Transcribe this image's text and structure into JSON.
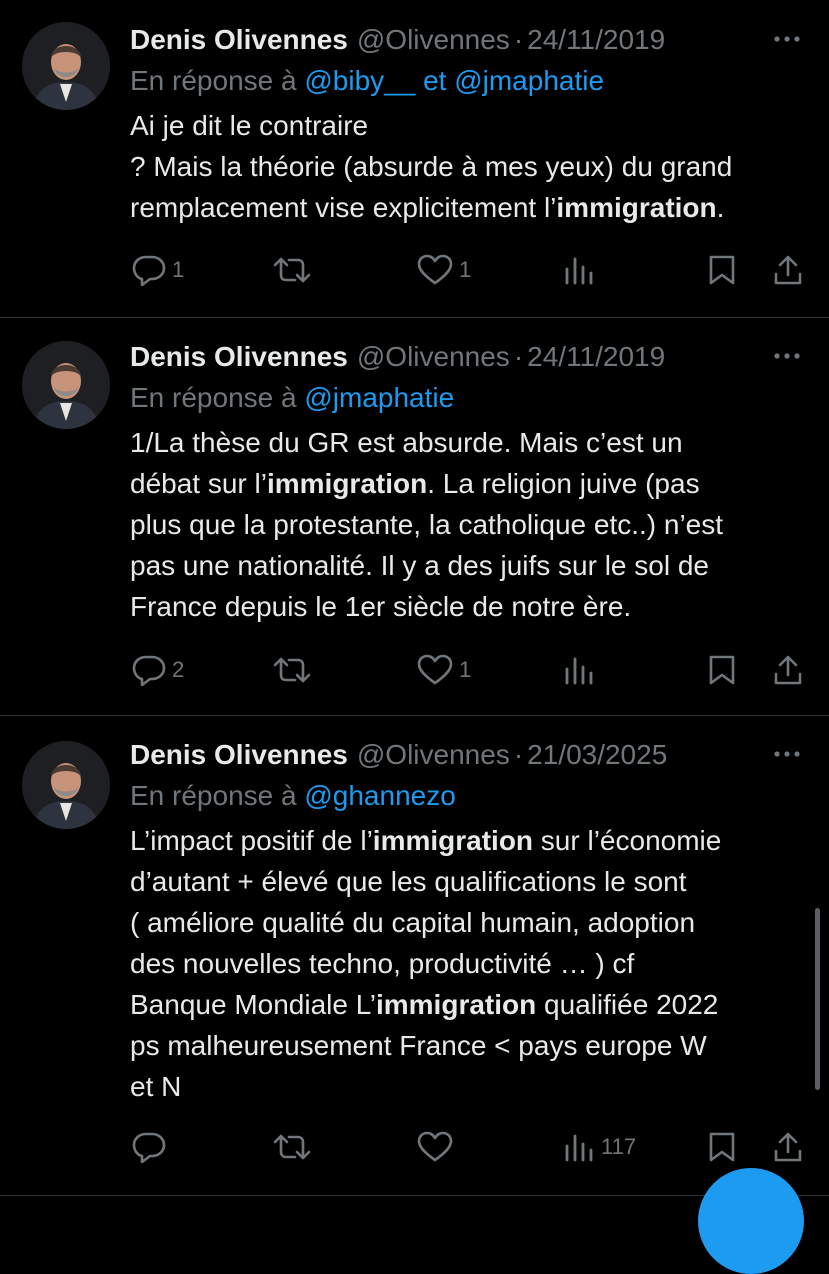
{
  "tweets": [
    {
      "name": "Denis Olivennes",
      "handle": "@Olivennes",
      "separator": "·",
      "date": "24/11/2019",
      "reply_prefix": "En réponse à",
      "mentions": [
        "@biby__",
        "et @jmaphatie"
      ],
      "text_lines": [
        [
          {
            "t": "Ai je dit le contraire",
            "b": false
          }
        ],
        [
          {
            "t": "? Mais la théorie (absurde à mes yeux) du grand",
            "b": false
          }
        ],
        [
          {
            "t": "remplacement vise explicitement l’",
            "b": false
          },
          {
            "t": "immigration",
            "b": true
          },
          {
            "t": ".",
            "b": false
          }
        ]
      ],
      "replies": "1",
      "retweets": "",
      "likes": "1",
      "views": ""
    },
    {
      "name": "Denis Olivennes",
      "handle": "@Olivennes",
      "separator": "·",
      "date": "24/11/2019",
      "reply_prefix": "En réponse à",
      "mentions": [
        "@jmaphatie"
      ],
      "text_lines": [
        [
          {
            "t": "1/La thèse du GR est absurde. Mais c’est un",
            "b": false
          }
        ],
        [
          {
            "t": "débat sur l’",
            "b": false
          },
          {
            "t": "immigration",
            "b": true
          },
          {
            "t": ". La religion juive (pas",
            "b": false
          }
        ],
        [
          {
            "t": "plus que la protestante, la catholique etc..) n’est",
            "b": false
          }
        ],
        [
          {
            "t": "pas une nationalité. Il y a des juifs sur le sol de",
            "b": false
          }
        ],
        [
          {
            "t": "France depuis le 1er siècle de notre ère.",
            "b": false
          }
        ]
      ],
      "replies": "2",
      "retweets": "",
      "likes": "1",
      "views": ""
    },
    {
      "name": "Denis Olivennes",
      "handle": "@Olivennes",
      "separator": "·",
      "date": "21/03/2025",
      "reply_prefix": "En réponse à",
      "mentions": [
        "@ghannezo"
      ],
      "text_lines": [
        [
          {
            "t": "L’impact positif de l’",
            "b": false
          },
          {
            "t": "immigration",
            "b": true
          },
          {
            "t": " sur l’économie",
            "b": false
          }
        ],
        [
          {
            "t": "d’autant + élevé que les qualifications le sont",
            "b": false
          }
        ],
        [
          {
            "t": "( améliore qualité du capital humain, adoption",
            "b": false
          }
        ],
        [
          {
            "t": "des nouvelles techno, productivité … ) cf",
            "b": false
          }
        ],
        [
          {
            "t": "Banque Mondiale L’",
            "b": false
          },
          {
            "t": "immigration",
            "b": true
          },
          {
            "t": " qualifiée 2022",
            "b": false
          }
        ],
        [
          {
            "t": "ps malheureusement France < pays europe W",
            "b": false
          }
        ],
        [
          {
            "t": "et N",
            "b": false
          }
        ]
      ],
      "replies": "",
      "retweets": "",
      "likes": "",
      "views": "117"
    }
  ],
  "icons": {
    "more": "more-icon",
    "reply": "reply-icon",
    "retweet": "retweet-icon",
    "like": "like-icon",
    "views": "views-icon",
    "bookmark": "bookmark-icon",
    "share": "share-icon"
  },
  "colors": {
    "background": "#000000",
    "text": "#e7e9ea",
    "muted": "#71767b",
    "accent": "#1d9bf0",
    "divider": "#2f3336"
  }
}
